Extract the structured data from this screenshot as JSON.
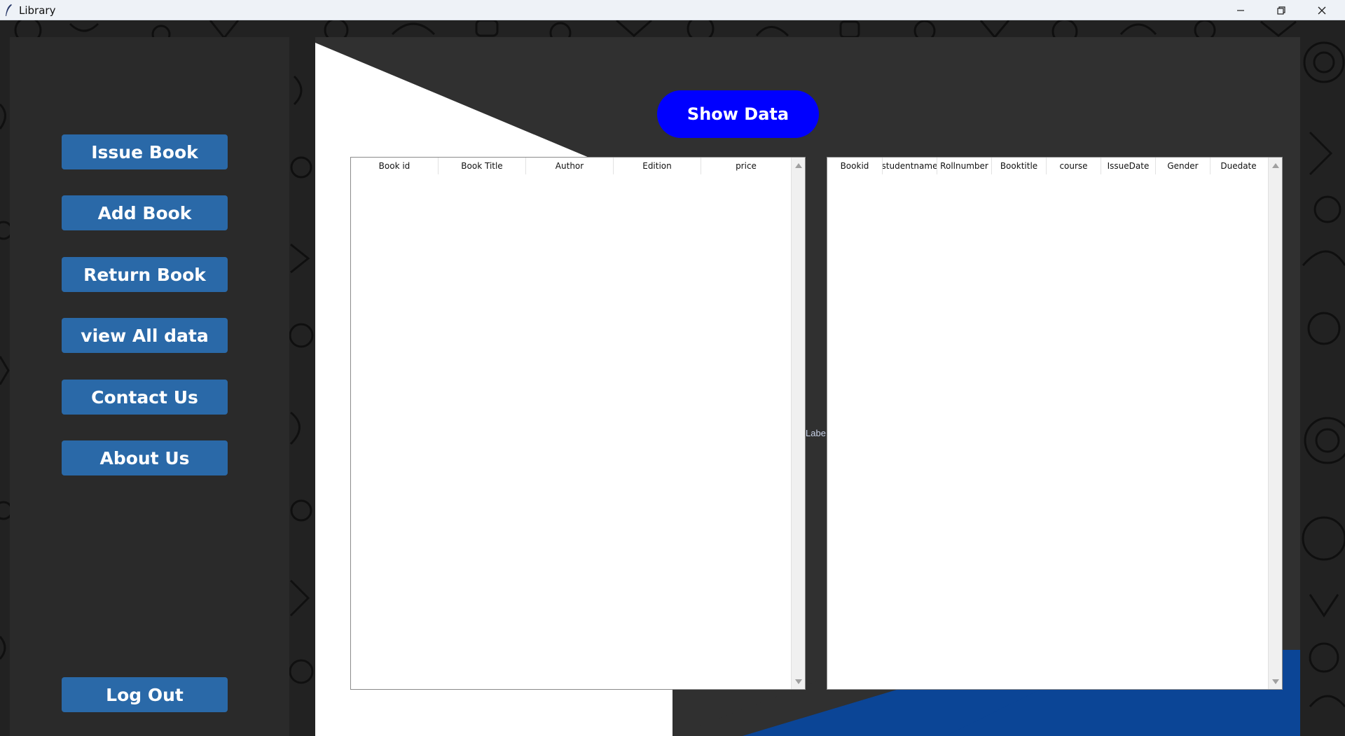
{
  "window": {
    "title": "Library",
    "minimize_icon": "minimize-icon",
    "restore_icon": "restore-icon",
    "close_icon": "close-icon"
  },
  "sidebar": {
    "items": [
      {
        "label": "Issue Book"
      },
      {
        "label": "Add Book"
      },
      {
        "label": "Return Book"
      },
      {
        "label": "view All data"
      },
      {
        "label": "Contact Us"
      },
      {
        "label": "About Us"
      }
    ],
    "logout_label": "Log Out"
  },
  "main": {
    "show_data_label": "Show Data",
    "ghost_label": "Labe",
    "books_table": {
      "columns": [
        "Book id",
        "Book Title",
        "Author",
        "Edition",
        "price"
      ],
      "rows": []
    },
    "issued_table": {
      "columns": [
        "Bookid",
        "studentname",
        "Rollnumber",
        "Booktitle",
        "course",
        "IssueDate",
        "Gender",
        "Duedate"
      ],
      "rows": []
    }
  },
  "colors": {
    "sidebar_button": "#2a69a8",
    "show_data_button": "#0000ff",
    "accent_blue": "#0b4596",
    "panel_dark": "#303030",
    "sidebar_bg": "#2a2a2a"
  }
}
